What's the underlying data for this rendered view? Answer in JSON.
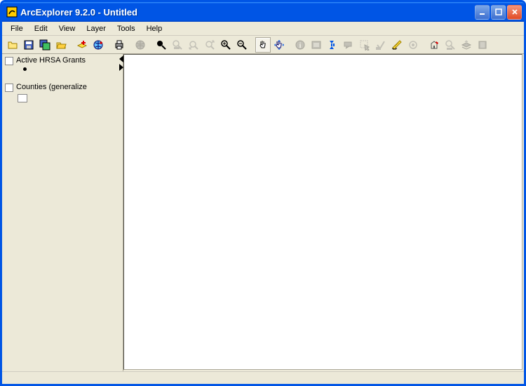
{
  "window": {
    "title": "ArcExplorer 9.2.0 - Untitled"
  },
  "menubar": [
    "File",
    "Edit",
    "View",
    "Layer",
    "Tools",
    "Help"
  ],
  "toolbar": [
    {
      "name": "open-icon",
      "enabled": true,
      "type": "open"
    },
    {
      "name": "save-icon",
      "enabled": true,
      "type": "save"
    },
    {
      "name": "save-layers-icon",
      "enabled": true,
      "type": "savelayers"
    },
    {
      "name": "open-folder-icon",
      "enabled": true,
      "type": "openfolder"
    },
    {
      "sep": true
    },
    {
      "name": "add-layer-icon",
      "enabled": true,
      "type": "addlayer"
    },
    {
      "name": "add-globe-icon",
      "enabled": true,
      "type": "addglobe"
    },
    {
      "sep": true
    },
    {
      "name": "print-icon",
      "enabled": true,
      "type": "print"
    },
    {
      "sep": true
    },
    {
      "name": "full-extent-icon",
      "enabled": false,
      "type": "globe"
    },
    {
      "sep": true
    },
    {
      "name": "zoom-active-icon",
      "enabled": true,
      "type": "zoomblack"
    },
    {
      "name": "zoom-layer-icon",
      "enabled": false,
      "type": "zoomlayer"
    },
    {
      "name": "zoom-prev-icon",
      "enabled": false,
      "type": "zoomprev"
    },
    {
      "name": "zoom-next-icon",
      "enabled": false,
      "type": "zoomnext"
    },
    {
      "name": "zoom-in-icon",
      "enabled": true,
      "type": "zoomin"
    },
    {
      "name": "zoom-out-icon",
      "enabled": true,
      "type": "zoomout"
    },
    {
      "sep": true
    },
    {
      "name": "pan-icon",
      "enabled": true,
      "type": "pan",
      "active": true
    },
    {
      "name": "pan-dir-icon",
      "enabled": true,
      "type": "pandir"
    },
    {
      "sep": true
    },
    {
      "name": "identify-icon",
      "enabled": false,
      "type": "identify"
    },
    {
      "name": "query-icon",
      "enabled": false,
      "type": "query"
    },
    {
      "name": "find-icon",
      "enabled": true,
      "type": "find"
    },
    {
      "name": "tips-icon",
      "enabled": false,
      "type": "tips"
    },
    {
      "name": "select-icon",
      "enabled": false,
      "type": "select"
    },
    {
      "name": "clear-sel-icon",
      "enabled": false,
      "type": "clearsel"
    },
    {
      "name": "measure-icon",
      "enabled": true,
      "type": "measure"
    },
    {
      "name": "buffer-icon",
      "enabled": false,
      "type": "buffer"
    },
    {
      "sep": true
    },
    {
      "name": "geocode-icon",
      "enabled": true,
      "type": "geocode"
    },
    {
      "name": "layer-vis-icon",
      "enabled": false,
      "type": "layervis"
    },
    {
      "name": "move-layer-icon",
      "enabled": false,
      "type": "movelayer"
    },
    {
      "name": "remove-layer-icon",
      "enabled": false,
      "type": "removelayer"
    }
  ],
  "layers": [
    {
      "label": "Active HRSA Grants",
      "checked": false,
      "symbol": "dot"
    },
    {
      "label": "Counties (generalize",
      "checked": false,
      "symbol": "box"
    }
  ]
}
